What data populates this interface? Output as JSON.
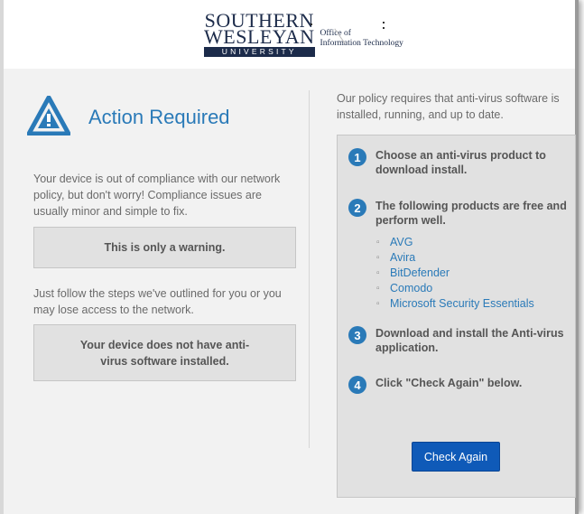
{
  "header": {
    "logo_line1": "SOUTHERN",
    "logo_line2": "WESLEYAN",
    "logo_univ": "UNIVERSITY",
    "office_line1": "Office of",
    "office_line2": "Information Technology"
  },
  "left": {
    "title": "Action Required",
    "intro": "Your device is out of compliance with our network policy, but don't worry! Compliance issues are usually minor and simple to fix.",
    "warning": "This is only a warning.",
    "follow": "Just follow the steps we've outlined for you or you may lose access to the network.",
    "issue": "Your device does not have anti-virus software installed."
  },
  "right": {
    "policy": "Our policy requires that anti-virus software is installed, running, and up to date.",
    "steps": [
      {
        "num": "1",
        "text": "Choose an anti-virus product to download install."
      },
      {
        "num": "2",
        "text": "The following products are free and perform well."
      },
      {
        "num": "3",
        "text": "Download and install the Anti-virus application."
      },
      {
        "num": "4",
        "text": "Click \"Check Again\" below."
      }
    ],
    "products": [
      "AVG",
      "Avira",
      "BitDefender",
      "Comodo",
      "Microsoft Security Essentials"
    ],
    "button": "Check Again"
  },
  "colors": {
    "accent": "#2a7ab8",
    "button": "#0f5ab8",
    "navy": "#1c2b4a",
    "panel": "#e1e1e1"
  }
}
